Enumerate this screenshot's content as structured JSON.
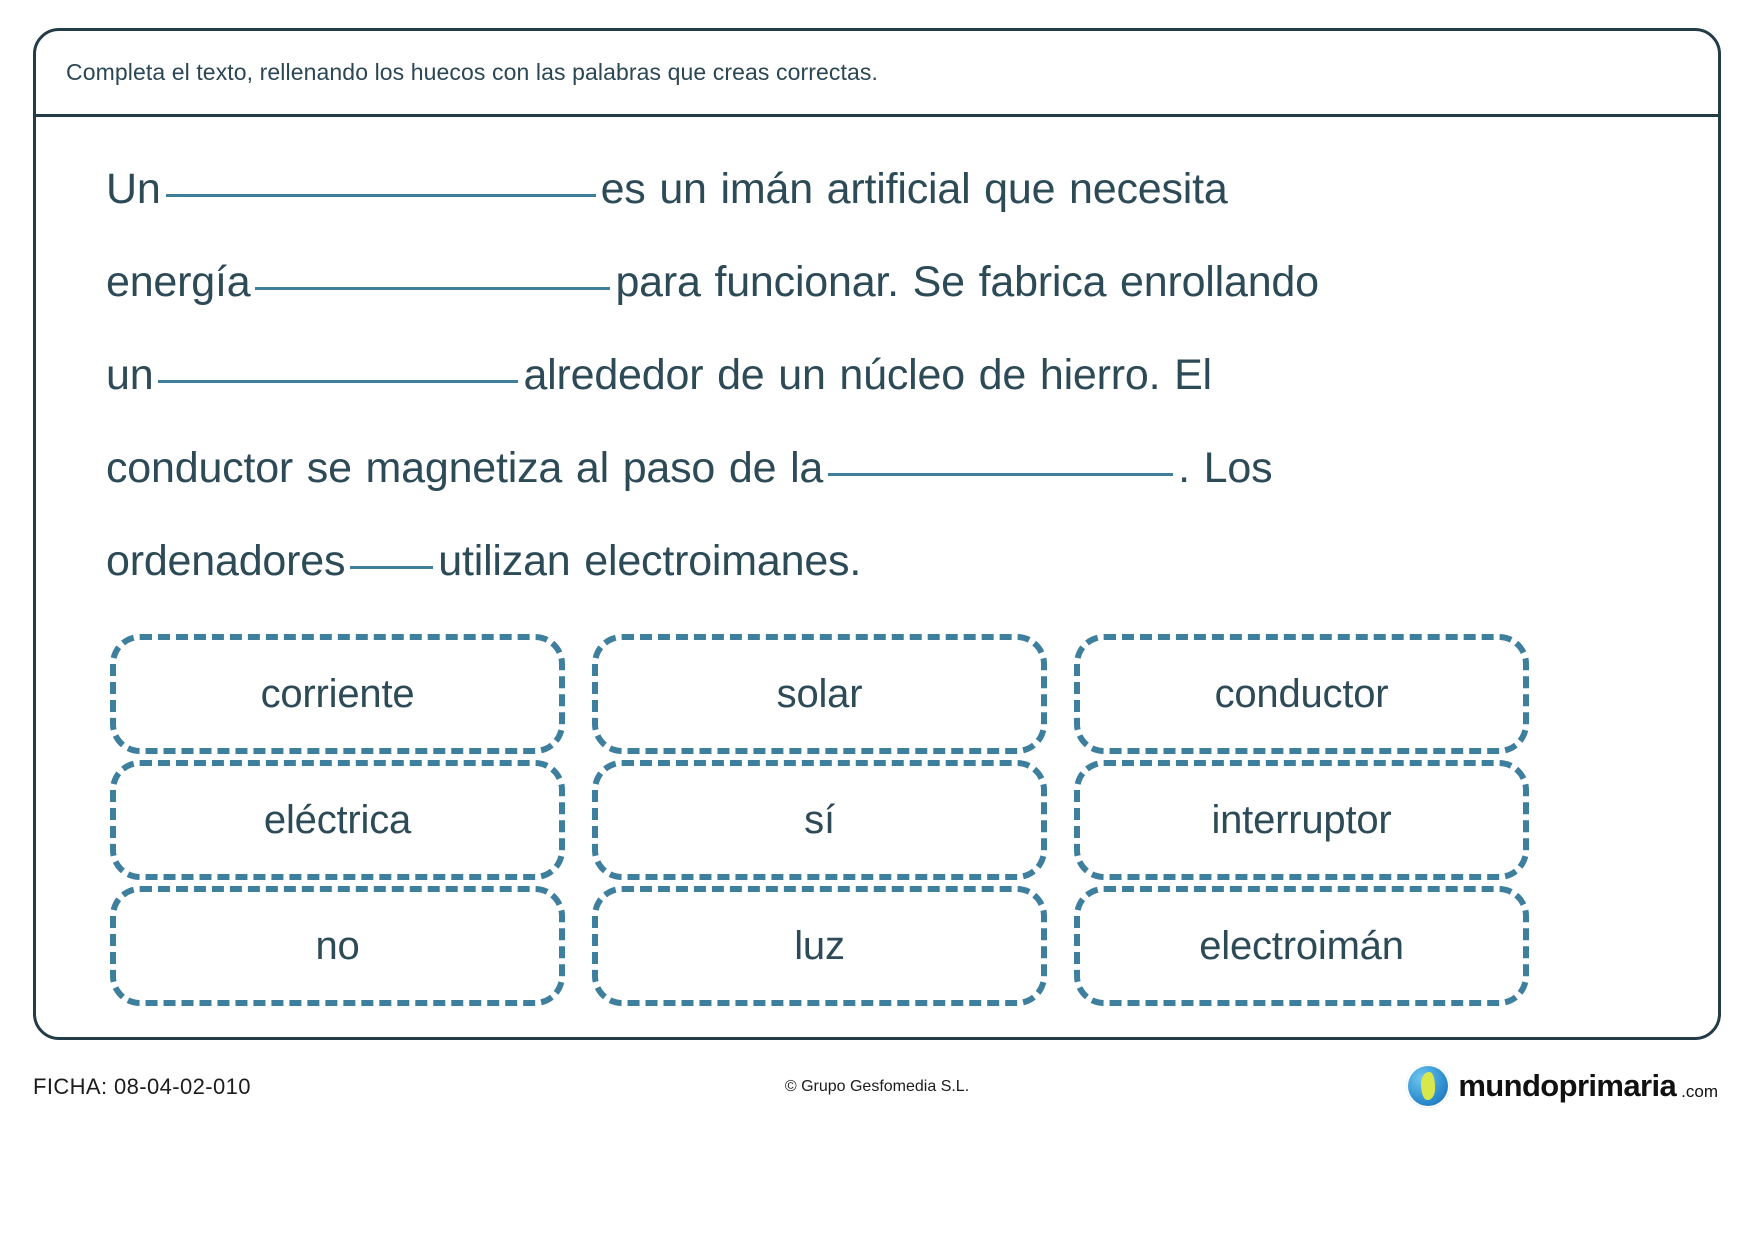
{
  "worksheet": {
    "instruction": "Completa el texto, rellenando los huecos con las palabras que creas correctas.",
    "text_segments": {
      "s1": "Un",
      "s2": "es un imán artificial que necesita",
      "s3": "energía",
      "s4": "para funcionar. Se fabrica enrollando",
      "s5": "un",
      "s6": "alrededor de un núcleo de hierro. El",
      "s7": "conductor se magnetiza al paso de la",
      "s8": ". Los",
      "s9": "ordenadores",
      "s10": "utilizan electroimanes."
    },
    "word_cards": [
      {
        "label": "corriente"
      },
      {
        "label": "solar"
      },
      {
        "label": "conductor"
      },
      {
        "label": "eléctrica"
      },
      {
        "label": "sí"
      },
      {
        "label": "interruptor"
      },
      {
        "label": "no"
      },
      {
        "label": "luz"
      },
      {
        "label": "electroimán"
      }
    ]
  },
  "footer": {
    "ficha": "FICHA: 08-04-02-010",
    "copyright": "© Grupo Gesfomedia S.L.",
    "logo_name": "mundoprimaria",
    "logo_tld": ".com"
  },
  "colors": {
    "border": "#243c48",
    "text": "#2d4a57",
    "accent": "#3f7f9e",
    "blank_line": "#3f7f99"
  }
}
